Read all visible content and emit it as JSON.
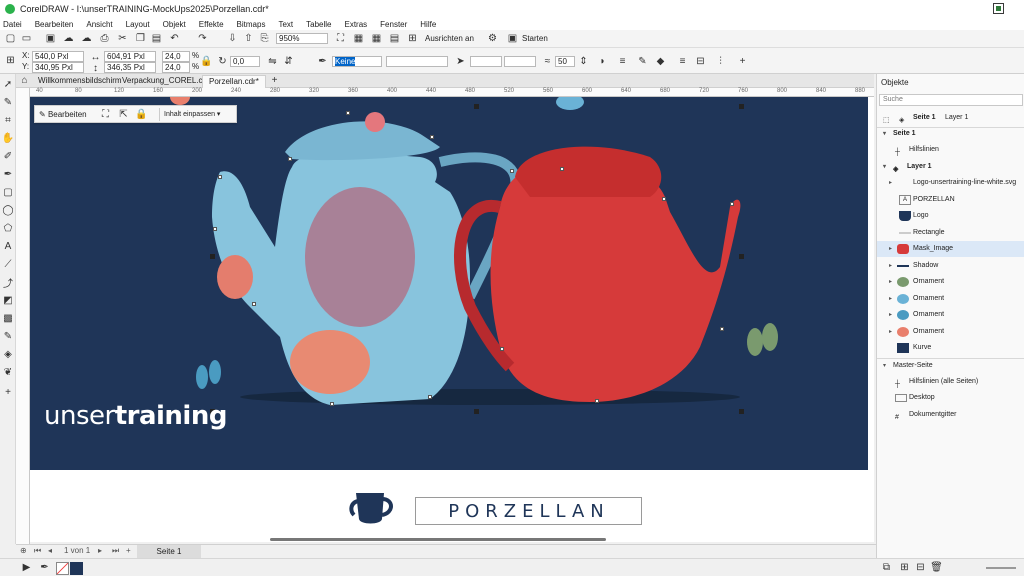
{
  "window": {
    "title": "CorelDRAW - I:\\unserTRAINING-MockUps2025\\Porzellan.cdr*"
  },
  "menu": [
    "Datei",
    "Bearbeiten",
    "Ansicht",
    "Layout",
    "Objekt",
    "Effekte",
    "Bitmaps",
    "Text",
    "Tabelle",
    "Extras",
    "Fenster",
    "Hilfe"
  ],
  "toolbar1": {
    "zoom": "950%",
    "snap_label": "Ausrichten an",
    "launch_label": "Starten"
  },
  "toolbar2": {
    "x": "540,0 Pxl",
    "y": "340,95 Pxl",
    "width": "604,91 Pxl",
    "height": "346,35 Pxl",
    "scale_x": "24,0",
    "scale_y": "24,0",
    "scale_unit": "%",
    "rotation": "0,0",
    "outline": "Keine",
    "transparency": "50"
  },
  "doc_tabs": [
    "Willkommensbildschirm",
    "Verpackung_COREL.cdr",
    "Porzellan.cdr*"
  ],
  "ruler_numbers": [
    "40",
    "80",
    "120",
    "160",
    "200",
    "240",
    "280",
    "320",
    "360",
    "400",
    "440",
    "480",
    "520",
    "560",
    "600",
    "640",
    "680",
    "720",
    "760",
    "800",
    "840",
    "880"
  ],
  "context_toolbar": {
    "edit_label": "Bearbeiten",
    "fit_label": "Inhalt einpassen"
  },
  "canvas": {
    "logo_text_light": "unser",
    "logo_text_bold": "training",
    "porzellan": "PORZELLAN"
  },
  "page_nav": {
    "counter": "1 von 1",
    "page_tab": "Seite 1"
  },
  "panel": {
    "title": "Objekte",
    "search_placeholder": "Suche",
    "header_page": "Seite 1",
    "header_layer": "Layer 1",
    "rows": [
      {
        "label": "Seite 1",
        "icon": "collapse-icon"
      },
      {
        "label": "Hilfslinien",
        "icon": "guides-icon"
      },
      {
        "label": "Layer 1",
        "icon": "layer-icon"
      },
      {
        "label": "Logo-unsertraining-line-white.svg",
        "icon": "group-icon"
      },
      {
        "label": "PORZELLAN",
        "icon": "text-icon"
      },
      {
        "label": "Logo",
        "icon": "teapot-icon"
      },
      {
        "label": "Rectangle",
        "icon": "rectangle-icon"
      },
      {
        "label": "Mask_Image",
        "icon": "image-icon"
      },
      {
        "label": "Shadow",
        "icon": "shadow-icon"
      },
      {
        "label": "Ornament",
        "icon": "ornament-icon"
      },
      {
        "label": "Ornament",
        "icon": "ornament-icon"
      },
      {
        "label": "Ornament",
        "icon": "ornament-icon"
      },
      {
        "label": "Ornament",
        "icon": "ornament-icon"
      },
      {
        "label": "Kurve",
        "icon": "curve-icon"
      },
      {
        "label": "Master-Seite",
        "icon": "collapse-icon"
      },
      {
        "label": "Hilfslinien (alle Seiten)",
        "icon": "guides-icon"
      },
      {
        "label": "Desktop",
        "icon": "desktop-icon"
      },
      {
        "label": "Dokumentgitter",
        "icon": "grid-icon"
      }
    ]
  },
  "colors": {
    "artboard": "#1f3558",
    "accent_green": "#2bb24c",
    "highlight": "#dbe8f7"
  }
}
